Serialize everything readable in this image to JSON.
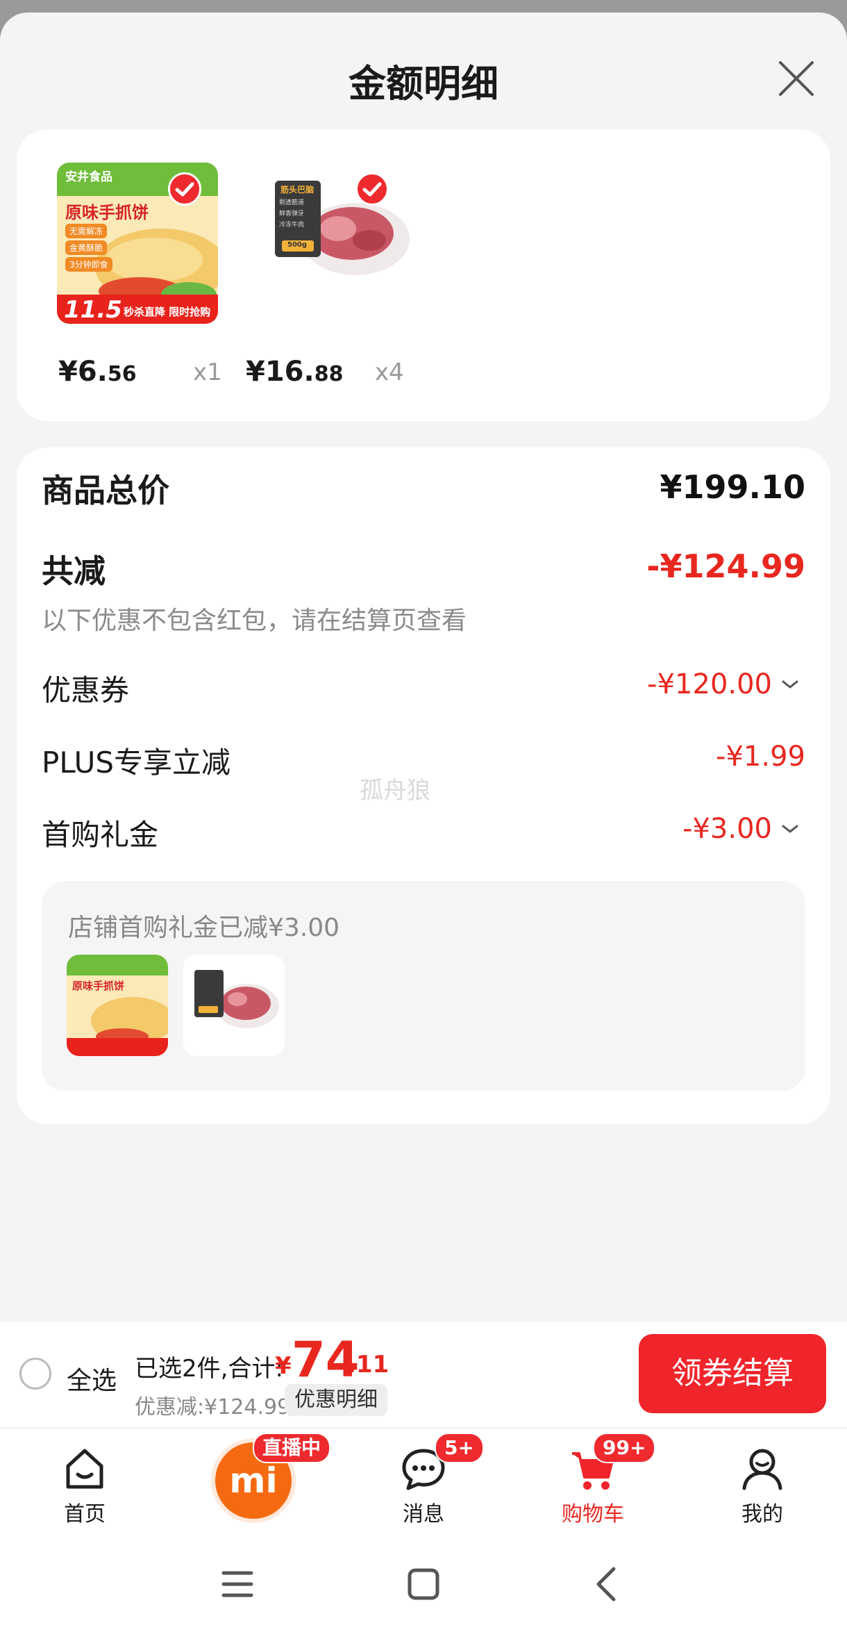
{
  "header": {
    "title": "金额明细"
  },
  "products": [
    {
      "brand": "安井食品",
      "name": "原味手抓饼",
      "tags": [
        "无需解冻",
        "金黄酥脆",
        "3分钟即食"
      ],
      "promo": "秒杀直降 限时抢购",
      "promo_price": "11.5",
      "price_int": "¥6.",
      "price_dec": "56",
      "qty": "x1"
    },
    {
      "brand": "筋头巴脑",
      "tags": [
        "剔透筋道",
        "鲜香弹牙",
        "冷冻牛肉"
      ],
      "weight": "500g",
      "price_int": "¥16.",
      "price_dec": "88",
      "qty": "x4"
    }
  ],
  "breakdown": {
    "total_label": "商品总价",
    "total_value": "¥199.10",
    "reduce_label": "共减",
    "reduce_value": "-¥124.99",
    "note": "以下优惠不包含红包，请在结算页查看",
    "coupon_label": "优惠券",
    "coupon_value": "-¥120.00",
    "plus_label": "PLUS专享立减",
    "plus_value": "-¥1.99",
    "gift_label": "首购礼金",
    "gift_value": "-¥3.00",
    "gift_note": "店铺首购礼金已减¥3.00"
  },
  "watermark": "孤舟狼",
  "checkout": {
    "select_all": "全选",
    "selected_text": "已选2件,合计:",
    "total_symbol": "¥",
    "total_int": "74",
    "total_dec": ".11",
    "discount_text": "优惠减:¥124.99",
    "discount_detail": "优惠明细",
    "button": "领券结算"
  },
  "tabs": [
    {
      "label": "首页",
      "icon": "home-icon"
    },
    {
      "label": "直播中",
      "icon": "mi-live-icon"
    },
    {
      "label": "消息",
      "icon": "message-icon",
      "badge": "5+"
    },
    {
      "label": "购物车",
      "icon": "cart-icon",
      "badge": "99+"
    },
    {
      "label": "我的",
      "icon": "profile-icon"
    }
  ],
  "colors": {
    "accent": "#e8271f",
    "button": "#f0252b",
    "live": "#f56a10"
  }
}
